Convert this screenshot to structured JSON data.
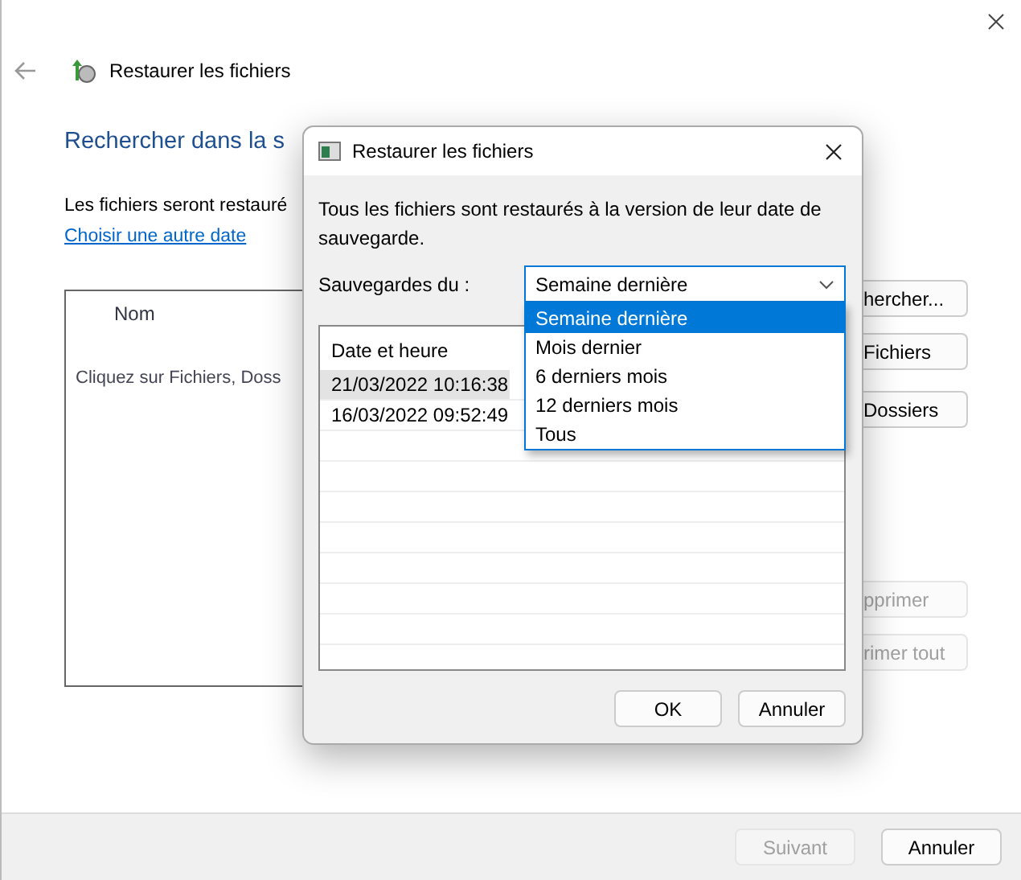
{
  "window": {
    "title": "Restaurer les fichiers"
  },
  "page": {
    "heading": "Rechercher dans la s",
    "info": "Les fichiers seront restauré",
    "link": "Choisir une autre date",
    "file_list": {
      "columns": [
        "Nom"
      ],
      "empty_text": "Cliquez sur Fichiers, Doss"
    },
    "side_buttons_top": [
      {
        "label": "hercher...",
        "disabled": false
      },
      {
        "label": "Fichiers",
        "disabled": false
      },
      {
        "label": "Dossiers",
        "disabled": false
      }
    ],
    "side_buttons_bottom": [
      {
        "label": "pprimer",
        "disabled": true
      },
      {
        "label": "rimer tout",
        "disabled": true
      }
    ]
  },
  "footer_buttons": [
    {
      "label": "Suivant",
      "disabled": true
    },
    {
      "label": "Annuler",
      "disabled": false
    }
  ],
  "dialog": {
    "title": "Restaurer les fichiers",
    "message": "Tous les fichiers sont restaurés à la version de leur date de sauvegarde.",
    "backups_label": "Sauvegardes du :",
    "backups_value": "Semaine dernière",
    "dropdown": [
      {
        "label": "Semaine dernière",
        "selected": true
      },
      {
        "label": "Mois dernier",
        "selected": false
      },
      {
        "label": "6 derniers mois",
        "selected": false
      },
      {
        "label": "12 derniers mois",
        "selected": false
      },
      {
        "label": "Tous",
        "selected": false
      }
    ],
    "table": {
      "columns": [
        "Date et heure"
      ],
      "rows": [
        {
          "cells": [
            "21/03/2022 10:16:38"
          ],
          "selected": true
        },
        {
          "cells": [
            "16/03/2022 09:52:49"
          ],
          "selected": false
        }
      ]
    },
    "buttons": [
      "OK",
      "Annuler"
    ]
  }
}
